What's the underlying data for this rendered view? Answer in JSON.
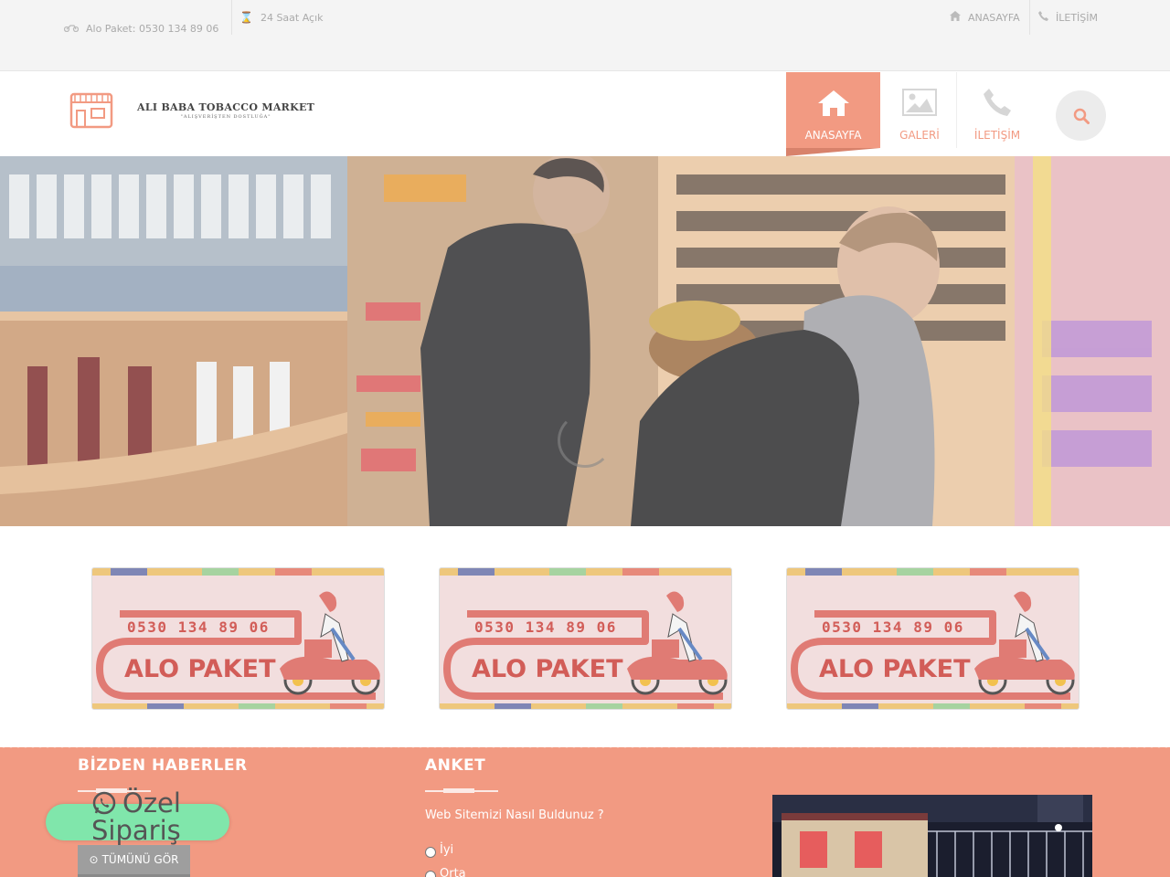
{
  "topbar": {
    "phone": "Alo Paket: 0530 134 89 06",
    "hours": "24 Saat Açık",
    "home_link": "ANASAYFA",
    "contact_link": "İLETİŞİM"
  },
  "header": {
    "logo_title": "ALI BABA TOBACCO MARKET",
    "logo_subtitle": "\"ALIŞVERİŞTEN DOSTLUĞA\"",
    "nav": [
      {
        "label": "ANASAYFA",
        "icon": "home-icon",
        "active": true
      },
      {
        "label": "GALERİ",
        "icon": "image-icon",
        "active": false
      },
      {
        "label": "İLETİŞİM",
        "icon": "phone-icon",
        "active": false
      }
    ]
  },
  "banners": [
    {
      "phone": "0530 134 89 06",
      "title": "ALO PAKET"
    },
    {
      "phone": "0530 134 89 06",
      "title": "ALO PAKET"
    },
    {
      "phone": "0530 134 89 06",
      "title": "ALO PAKET"
    }
  ],
  "footer": {
    "news_title": "BİZDEN HABERLER",
    "poll_title": "ANKET",
    "poll_question": "Web Sitemizi Nasıl Buldunuz ?",
    "poll_options": [
      "İyi",
      "Orta"
    ],
    "see_all": "TÜMÜNÜ GÖR"
  },
  "whatsapp": {
    "line1": "Özel",
    "line2": "Sipariş"
  },
  "colors": {
    "accent": "#f29a82",
    "whatsapp": "#80e6ab"
  }
}
